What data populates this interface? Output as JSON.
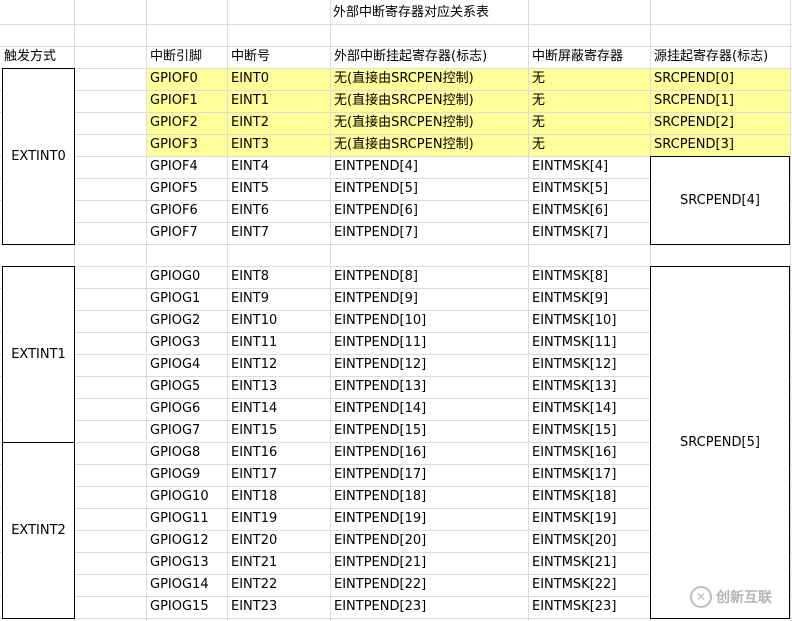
{
  "title": "外部中断寄存器对应关系表",
  "headers": {
    "trigger_mode": "触发方式",
    "pin": "中断引脚",
    "int_no": "中断号",
    "pending": "外部中断挂起寄存器(标志)",
    "mask": "中断屏蔽寄存器",
    "src_pending": "源挂起寄存器(标志)"
  },
  "groups": {
    "extint0": "EXTINT0",
    "extint1": "EXTINT1",
    "extint2": "EXTINT2"
  },
  "merged": {
    "srcpend4": "SRCPEND[4]",
    "srcpend5": "SRCPEND[5]"
  },
  "block1": [
    {
      "pin": "GPIOF0",
      "int": "EINT0",
      "pend": "无(直接由SRCPEN控制)",
      "mask": "无",
      "src": "SRCPEND[0]"
    },
    {
      "pin": "GPIOF1",
      "int": "EINT1",
      "pend": "无(直接由SRCPEN控制)",
      "mask": "无",
      "src": "SRCPEND[1]"
    },
    {
      "pin": "GPIOF2",
      "int": "EINT2",
      "pend": "无(直接由SRCPEN控制)",
      "mask": "无",
      "src": "SRCPEND[2]"
    },
    {
      "pin": "GPIOF3",
      "int": "EINT3",
      "pend": "无(直接由SRCPEN控制)",
      "mask": "无",
      "src": "SRCPEND[3]"
    },
    {
      "pin": "GPIOF4",
      "int": "EINT4",
      "pend": "EINTPEND[4]",
      "mask": "EINTMSK[4]",
      "src": ""
    },
    {
      "pin": "GPIOF5",
      "int": "EINT5",
      "pend": "EINTPEND[5]",
      "mask": "EINTMSK[5]",
      "src": ""
    },
    {
      "pin": "GPIOF6",
      "int": "EINT6",
      "pend": "EINTPEND[6]",
      "mask": "EINTMSK[6]",
      "src": ""
    },
    {
      "pin": "GPIOF7",
      "int": "EINT7",
      "pend": "EINTPEND[7]",
      "mask": "EINTMSK[7]",
      "src": ""
    }
  ],
  "block2": [
    {
      "pin": "GPIOG0",
      "int": "EINT8",
      "pend": "EINTPEND[8]",
      "mask": "EINTMSK[8]"
    },
    {
      "pin": "GPIOG1",
      "int": "EINT9",
      "pend": "EINTPEND[9]",
      "mask": "EINTMSK[9]"
    },
    {
      "pin": "GPIOG2",
      "int": "EINT10",
      "pend": "EINTPEND[10]",
      "mask": "EINTMSK[10]"
    },
    {
      "pin": "GPIOG3",
      "int": "EINT11",
      "pend": "EINTPEND[11]",
      "mask": "EINTMSK[11]"
    },
    {
      "pin": "GPIOG4",
      "int": "EINT12",
      "pend": "EINTPEND[12]",
      "mask": "EINTMSK[12]"
    },
    {
      "pin": "GPIOG5",
      "int": "EINT13",
      "pend": "EINTPEND[13]",
      "mask": "EINTMSK[13]"
    },
    {
      "pin": "GPIOG6",
      "int": "EINT14",
      "pend": "EINTPEND[14]",
      "mask": "EINTMSK[14]"
    },
    {
      "pin": "GPIOG7",
      "int": "EINT15",
      "pend": "EINTPEND[15]",
      "mask": "EINTMSK[15]"
    },
    {
      "pin": "GPIOG8",
      "int": "EINT16",
      "pend": "EINTPEND[16]",
      "mask": "EINTMSK[16]"
    },
    {
      "pin": "GPIOG9",
      "int": "EINT17",
      "pend": "EINTPEND[17]",
      "mask": "EINTMSK[17]"
    },
    {
      "pin": "GPIOG10",
      "int": "EINT18",
      "pend": "EINTPEND[18]",
      "mask": "EINTMSK[18]"
    },
    {
      "pin": "GPIOG11",
      "int": "EINT19",
      "pend": "EINTPEND[19]",
      "mask": "EINTMSK[19]"
    },
    {
      "pin": "GPIOG12",
      "int": "EINT20",
      "pend": "EINTPEND[20]",
      "mask": "EINTMSK[20]"
    },
    {
      "pin": "GPIOG13",
      "int": "EINT21",
      "pend": "EINTPEND[21]",
      "mask": "EINTMSK[21]"
    },
    {
      "pin": "GPIOG14",
      "int": "EINT22",
      "pend": "EINTPEND[22]",
      "mask": "EINTMSK[22]"
    },
    {
      "pin": "GPIOG15",
      "int": "EINT23",
      "pend": "EINTPEND[23]",
      "mask": "EINTMSK[23]"
    }
  ],
  "watermark": {
    "mark": "✕",
    "text": "创新互联"
  }
}
